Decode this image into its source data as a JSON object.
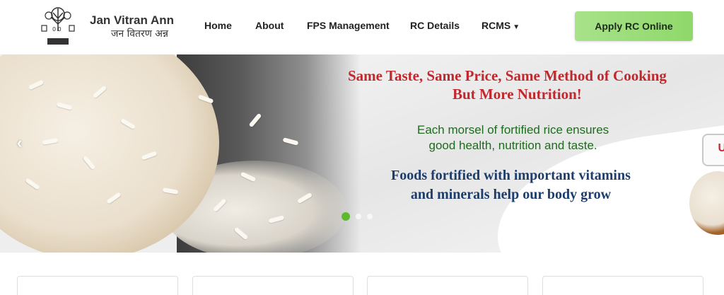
{
  "brand": {
    "name_en": "Jan Vitran Ann",
    "name_hi": "जन वितरण अन्न",
    "logo_badge": "AJRP"
  },
  "nav": {
    "items": [
      {
        "label": "Home"
      },
      {
        "label": "About"
      },
      {
        "label": "FPS Management"
      },
      {
        "label": "RC Details"
      },
      {
        "label": "RCMS",
        "has_dropdown": true
      }
    ],
    "cta_label": "Apply RC Online"
  },
  "banner": {
    "headline_line1": "Same Taste, Same Price, Same Method of Cooking",
    "headline_line2": "But More Nutrition!",
    "green_line1": "Each morsel of fortified rice ensures",
    "green_line2": "good health, nutrition and taste.",
    "blue_line1": "Foods fortified with important vitamins",
    "blue_line2": "and minerals help our body grow",
    "side_badge_text": "U",
    "prev_arrow": "‹",
    "active_slide": 1
  },
  "colors": {
    "accent_green": "#8fd86a",
    "headline_red": "#c0282d",
    "text_green": "#1f6b1f",
    "text_blue": "#1d3d6b"
  }
}
